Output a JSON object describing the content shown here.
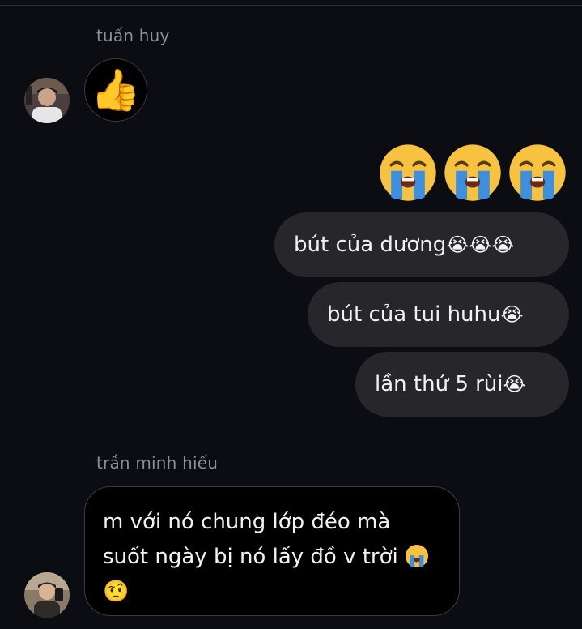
{
  "conversation": {
    "sender_1": {
      "name": "tuấn huy"
    },
    "sender_2": {
      "name": "trần minh hiếu"
    },
    "message_thumb": {
      "emoji": "👍"
    },
    "message_big_emoji": {
      "emojis": [
        "😭",
        "😭",
        "😭"
      ]
    },
    "outgoing": [
      {
        "text": "bút của dương",
        "emoji_suffix": "😭😭😭"
      },
      {
        "text": "bút của tui huhu ",
        "emoji_suffix": "😭"
      },
      {
        "text": "lần thứ 5 rùi ",
        "emoji_suffix": "😭"
      }
    ],
    "incoming_text": {
      "line1": "m với nó chung lớp đéo mà",
      "line2": "suốt ngày bị nó lấy đồ v trời ",
      "line3_emoji": "🤨"
    }
  },
  "colors": {
    "background": "#0c0d12",
    "outgoing_bubble": "#26262b",
    "incoming_bubble": "#000000",
    "name_text": "#8e8f96"
  },
  "icons": {
    "crying": "loudly-crying-face-icon",
    "thumbs_up": "thumbs-up-icon",
    "raised_eyebrow": "face-with-raised-eyebrow-icon"
  }
}
